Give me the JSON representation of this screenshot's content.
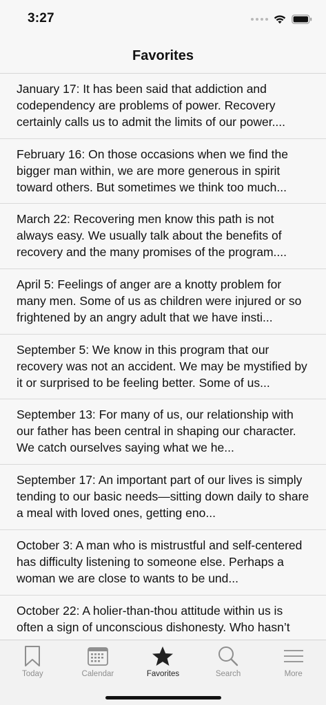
{
  "status_bar": {
    "time": "3:27"
  },
  "header": {
    "title": "Favorites"
  },
  "entries": [
    {
      "text": "January 17:  It has been said that addiction and codependency are problems of power. Recovery certainly calls us to admit the limits of our power...."
    },
    {
      "text": "February 16:  On those occasions when we find the bigger man within, we are more generous in spirit toward others. But sometimes we think too much..."
    },
    {
      "text": "March 22:  Recovering men know this path is not always easy. We usually talk about the benefits of recovery and the many promises of the program...."
    },
    {
      "text": "April 5:  Feelings of anger are a knotty problem for many men. Some of us as children were injured or so frightened by an angry adult that we have insti..."
    },
    {
      "text": "September 5:  We know in this program that our recovery was not an accident. We may be mystified by it or surprised to be feeling better. Some of us..."
    },
    {
      "text": "September 13:  For many of us, our relationship with our father has been central in shaping our character. We catch ourselves saying what we he..."
    },
    {
      "text": "September 17:  An important part of our lives is simply tending to our basic needs—sitting down daily to share a meal with loved ones, getting eno..."
    },
    {
      "text": "October 3:  A man who is mistrustful and self-centered has difficulty listening to someone else. Perhaps a woman we are close to wants to be und..."
    },
    {
      "text": "October 22:  A holier-than-thou attitude within us is often a sign of unconscious dishonesty. Who hasn’t"
    }
  ],
  "tab_bar": {
    "tabs": [
      {
        "label": "Today",
        "icon": "bookmark-icon"
      },
      {
        "label": "Calendar",
        "icon": "calendar-icon"
      },
      {
        "label": "Favorites",
        "icon": "star-icon",
        "active": true
      },
      {
        "label": "Search",
        "icon": "search-icon"
      },
      {
        "label": "More",
        "icon": "more-lines-icon"
      }
    ]
  },
  "colors": {
    "background": "#f7f7f7",
    "tab_inactive": "#8e8e8e",
    "tab_active": "#222222",
    "divider": "#d9d9d9"
  }
}
